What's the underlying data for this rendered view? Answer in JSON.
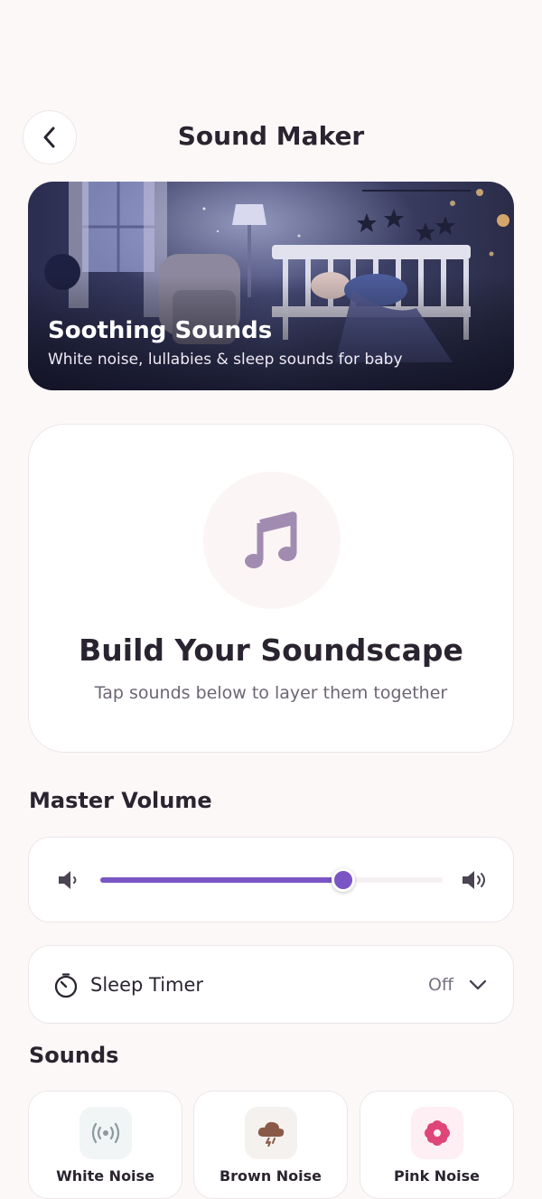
{
  "header": {
    "title": "Sound Maker",
    "back_icon": "chevron-left-icon"
  },
  "hero": {
    "title": "Soothing Sounds",
    "subtitle": "White noise, lullabies & sleep sounds for baby"
  },
  "soundscape": {
    "icon": "music-note-icon",
    "title": "Build Your Soundscape",
    "subtitle": "Tap sounds below to layer them together"
  },
  "master_volume": {
    "title": "Master Volume",
    "level": 0.71,
    "low_icon": "volume-low-icon",
    "high_icon": "volume-high-icon"
  },
  "sleep_timer": {
    "label": "Sleep Timer",
    "value": "Off",
    "icon": "timer-icon",
    "dropdown_icon": "chevron-down-icon"
  },
  "sounds": {
    "title": "Sounds",
    "items": [
      {
        "label": "White Noise",
        "icon": "broadcast-icon",
        "color": "#8a9aa0",
        "bg": "#f2f5f5"
      },
      {
        "label": "Brown Noise",
        "icon": "storm-cloud-icon",
        "color": "#8a5a48",
        "bg": "#f4f1ef"
      },
      {
        "label": "Pink Noise",
        "icon": "flower-icon",
        "color": "#e0457a",
        "bg": "#fdeff3"
      }
    ]
  },
  "colors": {
    "accent": "#7a55c4",
    "background": "#fdf8f8",
    "text": "#2a2430"
  }
}
